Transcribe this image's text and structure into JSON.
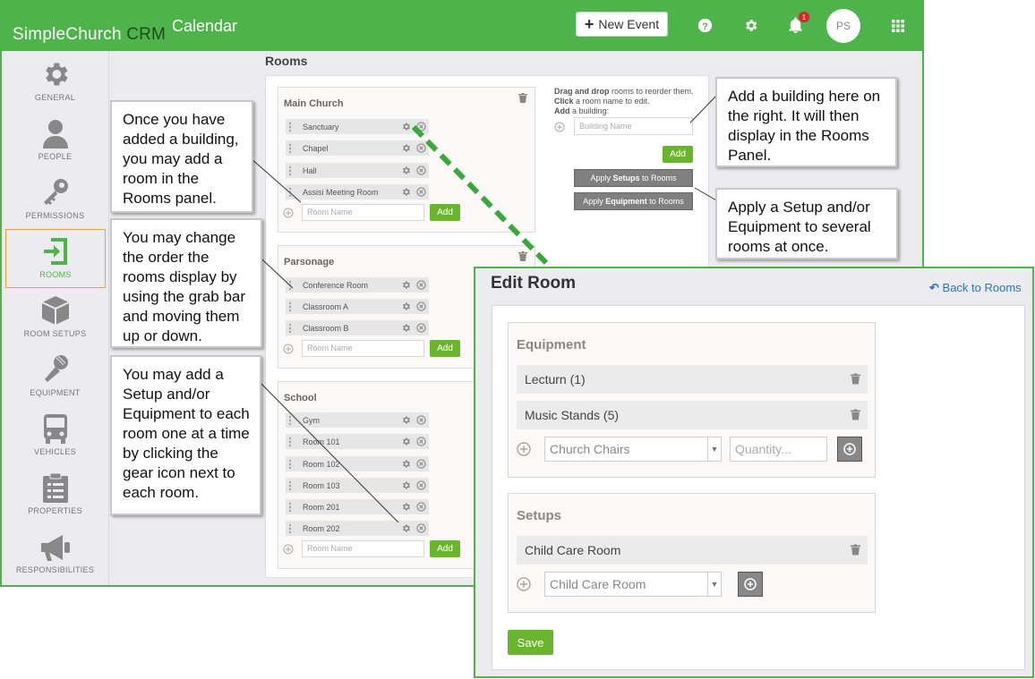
{
  "header": {
    "logo_simple": "SimpleChurch",
    "logo_crm": "CRM",
    "page_title": "Calendar",
    "new_event_label": "New Event",
    "notification_count": "1",
    "avatar_initials": "PS",
    "brand_color": "#4db34a"
  },
  "sidebar": {
    "items": [
      {
        "label": "GENERAL",
        "icon": "gear-icon"
      },
      {
        "label": "PEOPLE",
        "icon": "person-icon"
      },
      {
        "label": "PERMISSIONS",
        "icon": "key-icon"
      },
      {
        "label": "ROOMS",
        "icon": "door-icon"
      },
      {
        "label": "ROOM SETUPS",
        "icon": "cube-icon"
      },
      {
        "label": "EQUIPMENT",
        "icon": "microphone-icon"
      },
      {
        "label": "VEHICLES",
        "icon": "bus-icon"
      },
      {
        "label": "PROPERTIES",
        "icon": "clipboard-icon"
      },
      {
        "label": "RESPONSIBILITIES",
        "icon": "megaphone-icon"
      }
    ],
    "active": "ROOMS"
  },
  "rooms": {
    "heading": "Rooms",
    "room_placeholder": "Room Name",
    "add_label": "Add",
    "buildings": [
      {
        "name": "Main Church",
        "rooms": [
          "Sanctuary",
          "Chapel",
          "Hall",
          "Assisi Meeting Room"
        ]
      },
      {
        "name": "Parsonage",
        "rooms": [
          "Conference Room",
          "Classroom A",
          "Classroom B"
        ]
      },
      {
        "name": "School",
        "rooms": [
          "Gym",
          "Room 101",
          "Room 102",
          "Room 103",
          "Room 201",
          "Room 202"
        ]
      }
    ],
    "instructions": {
      "drag_bold": "Drag and drop",
      "drag_rest": " rooms to reorder them. ",
      "click_bold": "Click",
      "click_rest": " a room name to edit.",
      "add_bold": "Add",
      "add_rest": " a building:"
    },
    "building_placeholder": "Building Name",
    "apply_setups": {
      "pre": "Apply ",
      "bold": "Setups",
      "post": " to Rooms"
    },
    "apply_equipment": {
      "pre": "Apply ",
      "bold": "Equipment",
      "post": " to Rooms"
    }
  },
  "callouts": {
    "add_room": "Once you have added a building, you may add a room in the Rooms panel.",
    "reorder": "You may change the order the rooms display by using the grab bar and moving them up or down.",
    "gear": "You may add a Setup and/or Equipment to each room one at a time by clicking the gear icon next to each room.",
    "add_building": "Add a building here on the right. It will then display in the Rooms Panel.",
    "apply_several": "Apply a Setup and/or Equipment to several rooms at once."
  },
  "edit_room": {
    "title": "Edit Room",
    "back_label": "Back to Rooms",
    "equipment_heading": "Equipment",
    "equipment_items": [
      "Lecturn (1)",
      "Music Stands (5)"
    ],
    "equipment_select": "Church Chairs",
    "quantity_placeholder": "Quantity...",
    "setups_heading": "Setups",
    "setup_items": [
      "Child Care Room"
    ],
    "setup_select": "Child Care Room",
    "save_label": "Save"
  }
}
